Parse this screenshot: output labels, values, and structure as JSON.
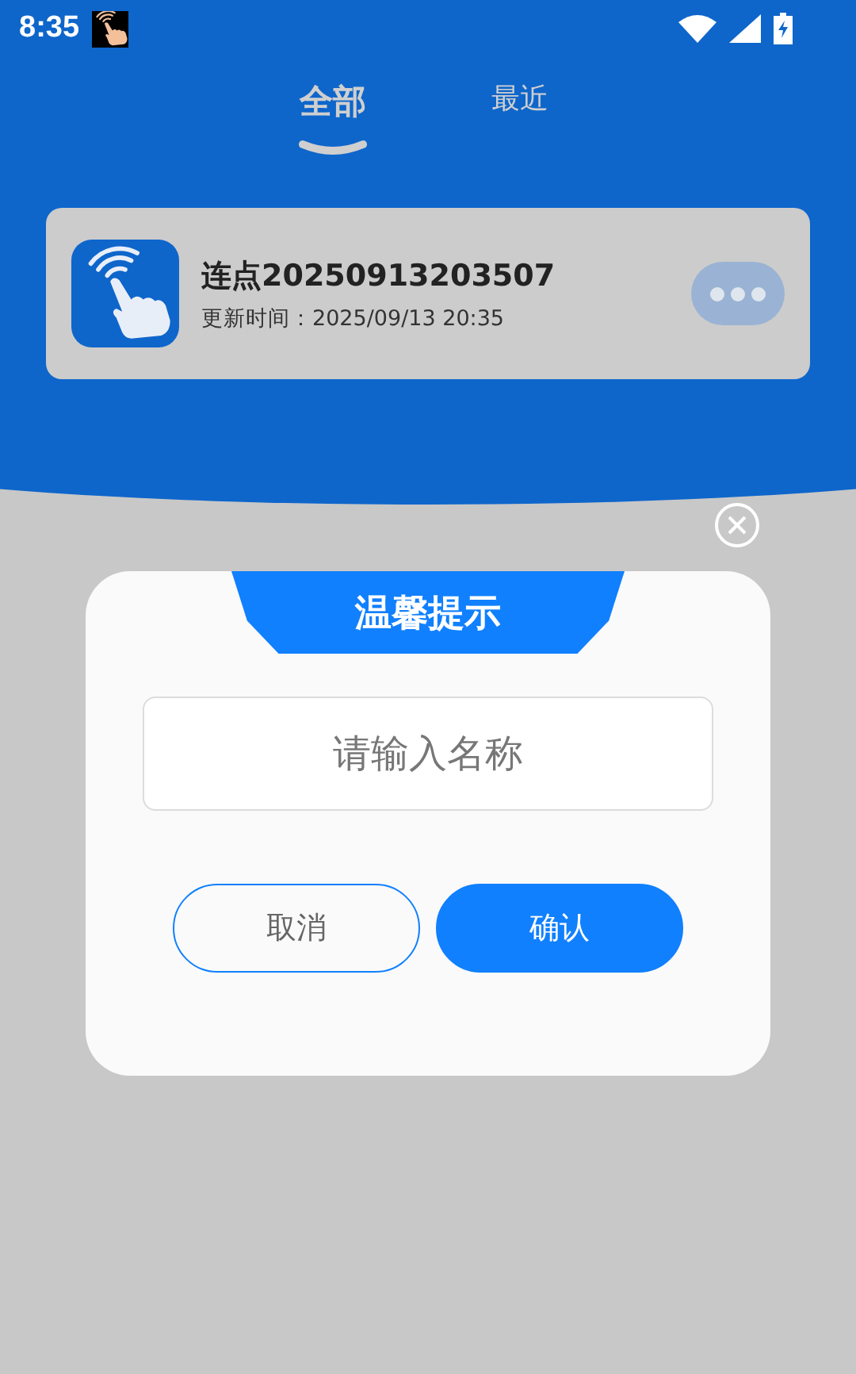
{
  "status_bar": {
    "time": "8:35"
  },
  "tabs": [
    {
      "label": "全部",
      "selected": true
    },
    {
      "label": "最近",
      "selected": false
    }
  ],
  "items": [
    {
      "title": "连点20250913203507",
      "updated": "更新时间：2025/09/13 20:35"
    }
  ],
  "dialog": {
    "title": "温馨提示",
    "input": {
      "placeholder": "请输入名称"
    },
    "buttons": [
      {
        "label": "取消",
        "kind": "secondary"
      },
      {
        "label": "确认",
        "kind": "primary"
      }
    ]
  }
}
